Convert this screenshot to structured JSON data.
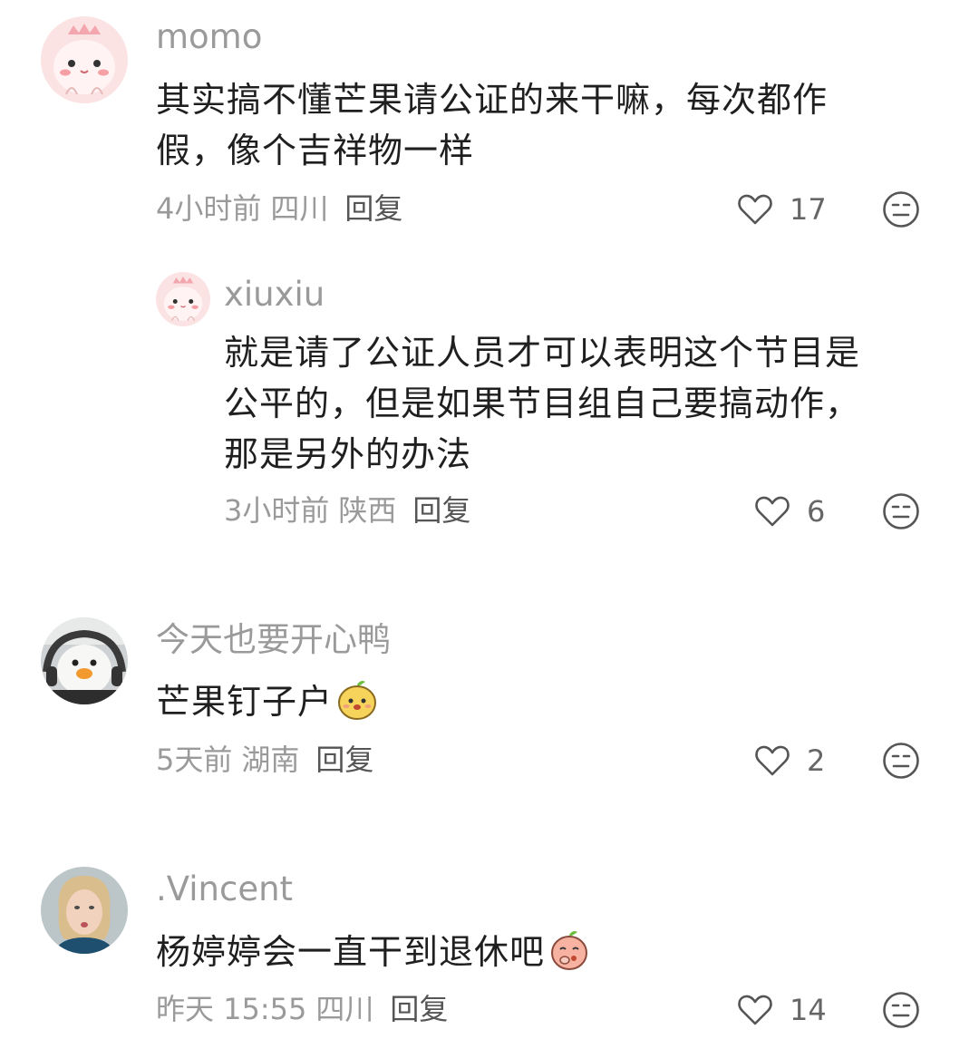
{
  "comments": [
    {
      "username": "momo",
      "content_lines": [
        "其实搞不懂芒果请公证的来干嘛，每次都作",
        "假，像个吉祥物一样"
      ],
      "time": "4小时前",
      "location": "四川",
      "reply_label": "回复",
      "likes": "17",
      "avatar_icon": "pink-dino-avatar-icon"
    },
    {
      "username": "xiuxiu",
      "content_lines": [
        "就是请了公证人员才可以表明这个节目是",
        "公平的，但是如果节目组自己要搞动作，",
        "那是另外的办法"
      ],
      "time": "3小时前",
      "location": "陕西",
      "reply_label": "回复",
      "likes": "6",
      "avatar_icon": "pink-dino-avatar-icon"
    },
    {
      "username": "今天也要开心鸭",
      "content_lines": [
        "芒果钉子户"
      ],
      "emoji": "mango-face-emoji",
      "time": "5天前",
      "location": "湖南",
      "reply_label": "回复",
      "likes": "2",
      "avatar_icon": "duck-plush-avatar-icon"
    },
    {
      "username": ".Vincent",
      "content_lines": [
        "杨婷婷会一直干到退休吧"
      ],
      "emoji": "shy-peach-emoji",
      "time": "昨天 15:55",
      "location": "四川",
      "reply_label": "回复",
      "likes": "14",
      "avatar_icon": "portrait-avatar-icon"
    }
  ],
  "colors": {
    "meta_text": "#9a9a9a",
    "content_text": "#1f1f1f",
    "reply_text": "#555555",
    "icon_stroke": "#555555"
  }
}
